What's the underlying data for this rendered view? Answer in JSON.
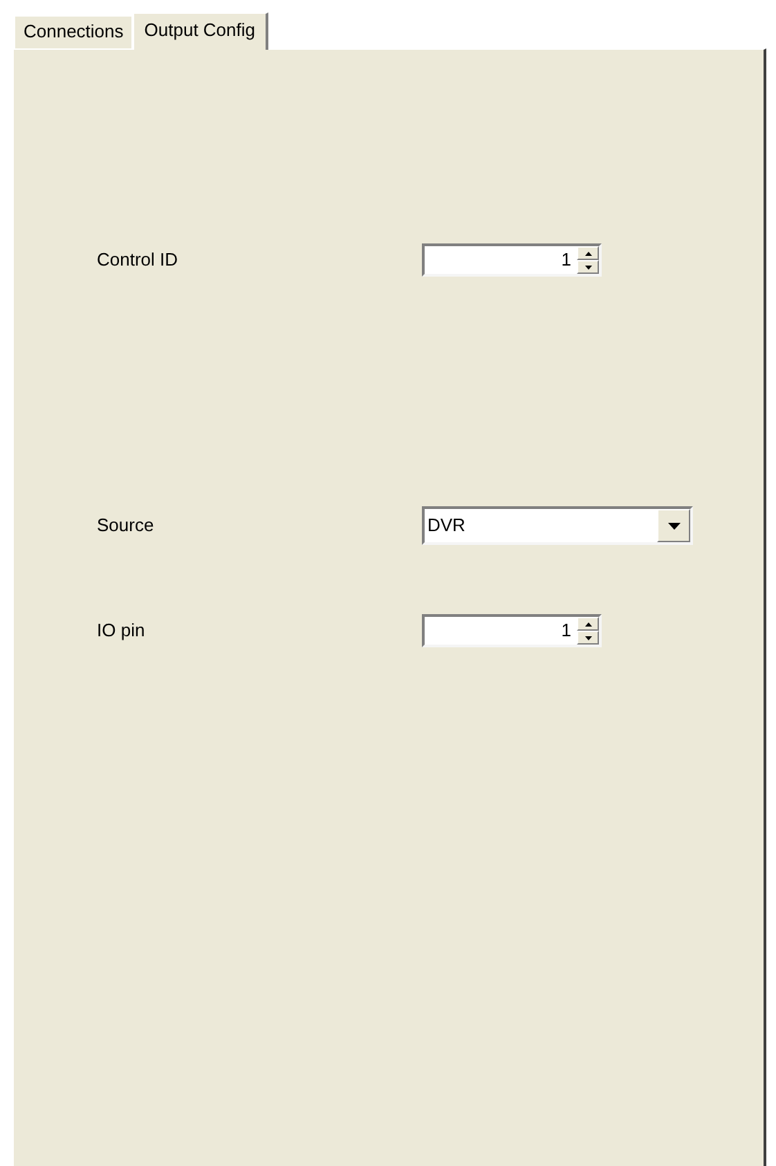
{
  "tabs": [
    {
      "label": "Connections",
      "selected": false
    },
    {
      "label": "Output Config",
      "selected": true
    }
  ],
  "fields": [
    {
      "kind": "spinner",
      "label": "Control ID",
      "value": "1"
    },
    {
      "kind": "combo",
      "label": "Source",
      "value": "DVR"
    },
    {
      "kind": "spinner",
      "label": "IO pin",
      "value": "1"
    }
  ]
}
